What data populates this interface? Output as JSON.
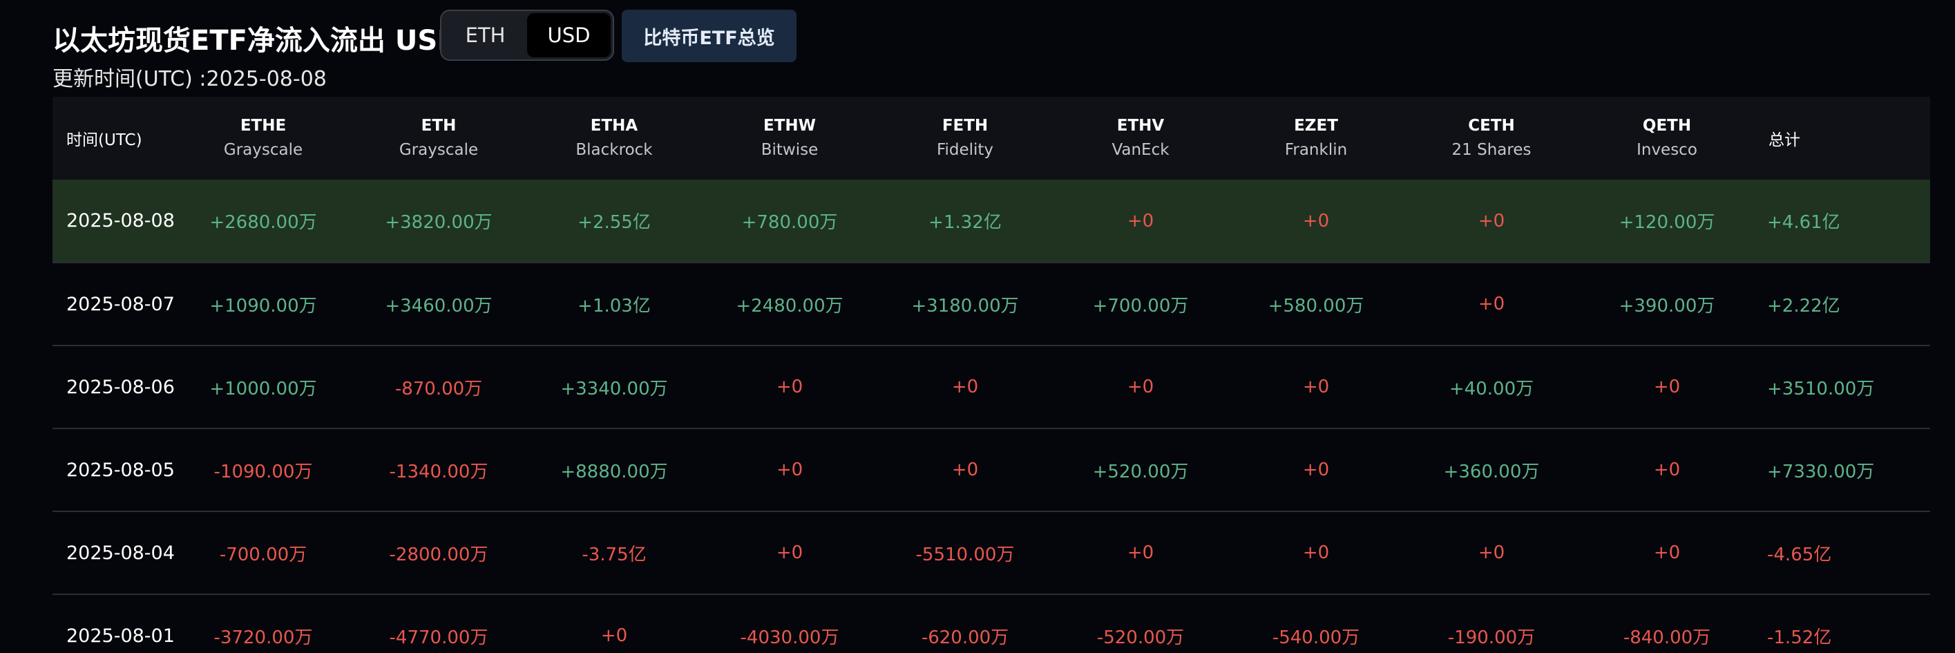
{
  "header": {
    "title": "以太坊现货ETF净流入流出 USD",
    "toggle": [
      "ETH",
      "USD"
    ],
    "active_toggle": "USD",
    "overview_button": "比特币ETF总览",
    "update_time": "更新时间(UTC) :2025-08-08"
  },
  "table": {
    "date_header": "时间(UTC)",
    "total_header": "总计",
    "columns": [
      {
        "code": "ETHE",
        "issuer": "Grayscale"
      },
      {
        "code": "ETH",
        "issuer": "Grayscale"
      },
      {
        "code": "ETHA",
        "issuer": "Blackrock"
      },
      {
        "code": "ETHW",
        "issuer": "Bitwise"
      },
      {
        "code": "FETH",
        "issuer": "Fidelity"
      },
      {
        "code": "ETHV",
        "issuer": "VanEck"
      },
      {
        "code": "EZET",
        "issuer": "Franklin"
      },
      {
        "code": "CETH",
        "issuer": "21 Shares"
      },
      {
        "code": "QETH",
        "issuer": "Invesco"
      }
    ],
    "rows": [
      {
        "date": "2025-08-08",
        "highlight": true,
        "values": [
          "+2680.00万",
          "+3820.00万",
          "+2.55亿",
          "+780.00万",
          "+1.32亿",
          "+0",
          "+0",
          "+0",
          "+120.00万"
        ],
        "total": "+4.61亿"
      },
      {
        "date": "2025-08-07",
        "highlight": false,
        "values": [
          "+1090.00万",
          "+3460.00万",
          "+1.03亿",
          "+2480.00万",
          "+3180.00万",
          "+700.00万",
          "+580.00万",
          "+0",
          "+390.00万"
        ],
        "total": "+2.22亿"
      },
      {
        "date": "2025-08-06",
        "highlight": false,
        "values": [
          "+1000.00万",
          "-870.00万",
          "+3340.00万",
          "+0",
          "+0",
          "+0",
          "+0",
          "+40.00万",
          "+0"
        ],
        "total": "+3510.00万"
      },
      {
        "date": "2025-08-05",
        "highlight": false,
        "values": [
          "-1090.00万",
          "-1340.00万",
          "+8880.00万",
          "+0",
          "+0",
          "+520.00万",
          "+0",
          "+360.00万",
          "+0"
        ],
        "total": "+7330.00万"
      },
      {
        "date": "2025-08-04",
        "highlight": false,
        "values": [
          "-700.00万",
          "-2800.00万",
          "-3.75亿",
          "+0",
          "-5510.00万",
          "+0",
          "+0",
          "+0",
          "+0"
        ],
        "total": "-4.65亿"
      },
      {
        "date": "2025-08-01",
        "highlight": false,
        "values": [
          "-3720.00万",
          "-4770.00万",
          "+0",
          "-4030.00万",
          "-620.00万",
          "-520.00万",
          "-540.00万",
          "-190.00万",
          "-840.00万"
        ],
        "total": "-1.52亿"
      }
    ],
    "zero_color_rule": "+0 rendered red except under QETH/total rules as shown",
    "colors": {
      "positive": "#5db38a",
      "negative": "#e8574d",
      "highlight_row": "#1f3320"
    }
  }
}
